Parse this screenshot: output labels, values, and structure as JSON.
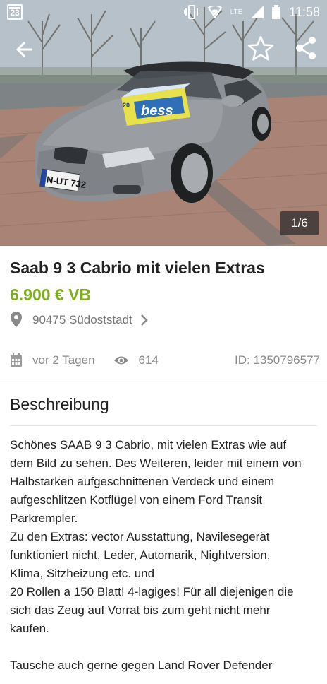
{
  "status_bar": {
    "calendar_day": "23",
    "time": "11:58",
    "network": "LTE",
    "icons": [
      "vibrate-icon",
      "wifi-icon",
      "signal-icon",
      "battery-icon"
    ]
  },
  "app_bar": {
    "icons": [
      "back-arrow-icon",
      "star-outline-icon",
      "share-icon"
    ]
  },
  "gallery": {
    "counter": "1/6",
    "license_plate": "N-UT 732",
    "product_label": "bess"
  },
  "listing": {
    "title": "Saab 9 3 Cabrio mit vielen Extras",
    "price": "6.900 € VB",
    "location": "90475 Südoststadt",
    "posted": "vor 2 Tagen",
    "views": "614",
    "ad_id": "ID: 1350796577"
  },
  "description": {
    "heading": "Beschreibung",
    "lines": [
      "Schönes SAAB 9 3 Cabrio, mit vielen Extras wie auf",
      "dem Bild zu sehen. Des Weiteren, leider mit einem von",
      "Halbstarken aufgeschnittenen Verdeck und einem",
      "aufgeschlitzen Kotflügel von einem Ford Transit",
      "Parkrempler.",
      "Zu den Extras: vector Ausstattung, Navilesegerät",
      "funktioniert nicht, Leder, Automarik, Nightversion,",
      "Klima, Sitzheizung etc. und",
      "20 Rollen a 150 Blatt! 4-lagiges! Für all diejenigen die",
      "sich das Zeug auf Vorrat bis zum geht nicht mehr",
      "kaufen.",
      "",
      "Tausche auch gerne gegen Land Rover Defender"
    ]
  },
  "colors": {
    "price": "#7aae1a",
    "text": "#222222",
    "muted": "#8a8a8a"
  }
}
